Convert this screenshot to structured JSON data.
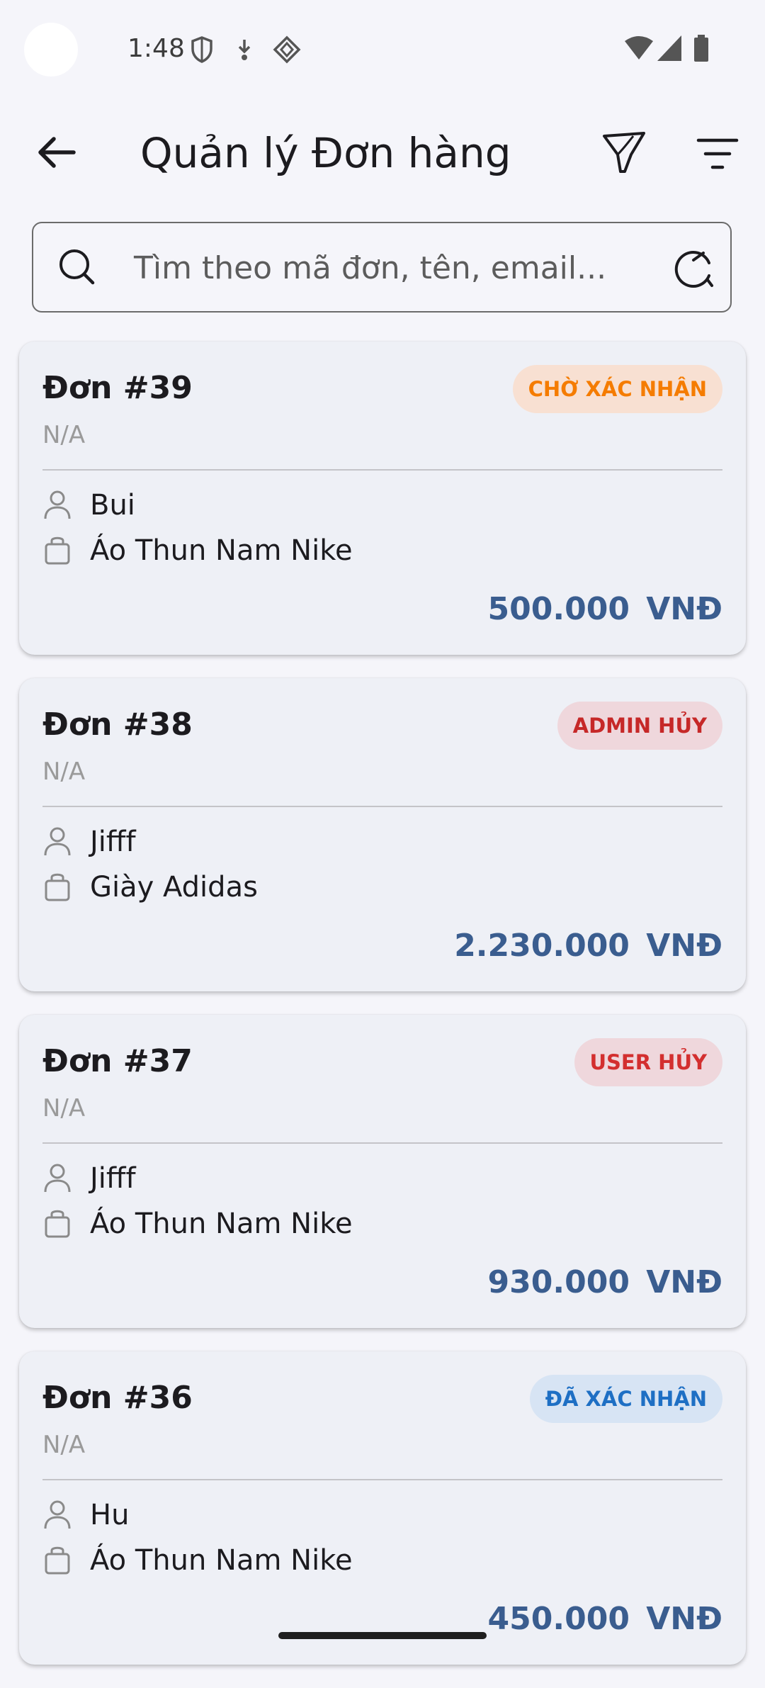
{
  "status_bar": {
    "time": "1:48",
    "icons": [
      "shield-icon",
      "download-icon",
      "diamond-icon",
      "wifi-icon",
      "signal-icon",
      "battery-icon"
    ]
  },
  "header": {
    "title": "Quản lý Đơn hàng",
    "icons": [
      "back-arrow-icon",
      "funnel-icon",
      "sort-icon"
    ]
  },
  "search": {
    "placeholder": "Tìm theo mã đơn, tên, email...",
    "icons": [
      "search-icon",
      "refresh-icon"
    ]
  },
  "orders": [
    {
      "id": "Đơn #39",
      "status": "CHỜ XÁC NHẬN",
      "status_color": "#f57c00",
      "status_bg": "#f8e0d2",
      "email": "N/A",
      "customer": "Bui",
      "product": "Áo Thun Nam Nike",
      "price": "500.000 VNĐ"
    },
    {
      "id": "Đơn #38",
      "status": "ADMIN HỦY",
      "status_color": "#c62828",
      "status_bg": "#efd7dc",
      "email": "N/A",
      "customer": "Jifff",
      "product": "Giày Adidas",
      "price": "2.230.000 VNĐ"
    },
    {
      "id": "Đơn #37",
      "status": "USER HỦY",
      "status_color": "#d32f2f",
      "status_bg": "#efd7dc",
      "email": "N/A",
      "customer": "Jifff",
      "product": "Áo Thun Nam Nike",
      "price": "930.000 VNĐ"
    },
    {
      "id": "Đơn #36",
      "status": "ĐÃ XÁC NHẬN",
      "status_color": "#1e6fc4",
      "status_bg": "#d7e4f4",
      "email": "N/A",
      "customer": "Hu",
      "product": "Áo Thun Nam Nike",
      "price": "450.000 VNĐ"
    }
  ],
  "colors": {
    "background": "#f5f5fa",
    "card": "#eef0f6",
    "price": "#3a5d8f"
  }
}
